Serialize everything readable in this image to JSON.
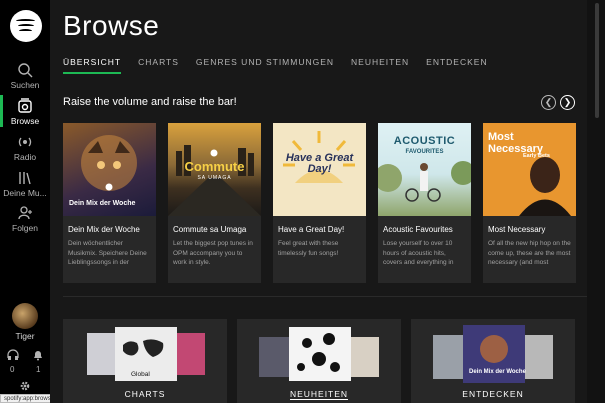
{
  "sidebar": {
    "items": [
      {
        "label": "Suchen",
        "icon": "search-icon"
      },
      {
        "label": "Browse",
        "icon": "browse-icon"
      },
      {
        "label": "Radio",
        "icon": "radio-icon"
      },
      {
        "label": "Deine Mu...",
        "icon": "library-icon"
      },
      {
        "label": "Folgen",
        "icon": "follow-icon"
      }
    ],
    "profile_name": "Tiger",
    "download_count": "0",
    "notification_count": "1"
  },
  "header": {
    "title": "Browse"
  },
  "tabs": [
    {
      "label": "ÜBERSICHT",
      "active": true
    },
    {
      "label": "CHARTS"
    },
    {
      "label": "GENRES UND STIMMUNGEN"
    },
    {
      "label": "NEUHEITEN"
    },
    {
      "label": "ENTDECKEN"
    }
  ],
  "section": {
    "title": "Raise the volume and raise the bar!"
  },
  "cards": [
    {
      "title": "Dein Mix der Woche",
      "desc": "Dein wöchentlicher Musikmix. Speichere Deine Lieblingssongs in der",
      "art_text": "Dein Mix der Woche"
    },
    {
      "title": "Commute sa Umaga",
      "desc": "Let the biggest pop tunes in OPM accompany you to work in style.",
      "art_text": "Commute",
      "art_sub": "SA UMAGA"
    },
    {
      "title": "Have a Great Day!",
      "desc": "Feel great with these timelessly fun songs!",
      "art_text": "Have a Great Day!"
    },
    {
      "title": "Acoustic Favourites",
      "desc": "Lose yourself to over 10 hours of acoustic hits, covers and everything in",
      "art_text": "ACOUSTIC",
      "art_sub": "FAVOURITES"
    },
    {
      "title": "Most Necessary",
      "desc": "Of all the new hip hop on the come up, these are the most necessary (and most",
      "art_text": "Most Necessary",
      "art_sub": "Early Bets"
    }
  ],
  "bottom_tiles": [
    {
      "label": "CHARTS",
      "art_text": "Global"
    },
    {
      "label": "NEUHEITEN"
    },
    {
      "label": "ENTDECKEN",
      "art_text": "Dein Mix der Woche"
    }
  ],
  "status_url": "spotify:app:browse:releases"
}
